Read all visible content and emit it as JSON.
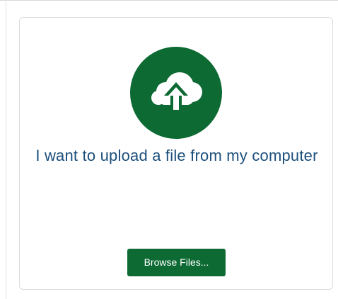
{
  "upload_panel": {
    "heading": "I want to upload a file from my computer",
    "icon": "cloud-upload-icon",
    "browse_button_label": "Browse Files..."
  },
  "colors": {
    "accent": "#0d6a33",
    "heading_text": "#1c4f7c",
    "card_border": "#dcdcdc"
  }
}
